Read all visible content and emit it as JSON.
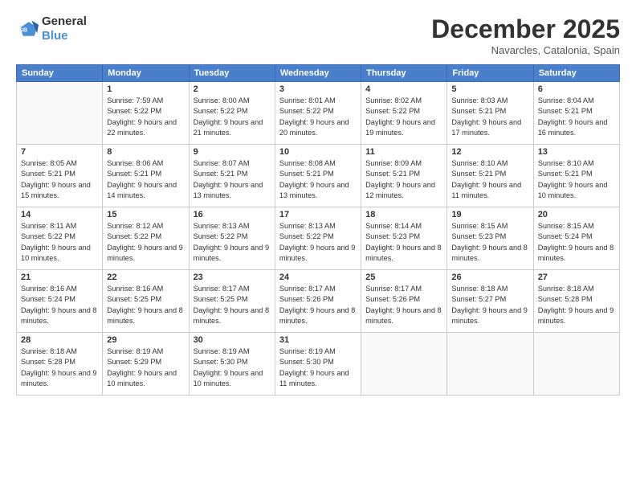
{
  "logo": {
    "general": "General",
    "blue": "Blue"
  },
  "title": "December 2025",
  "location": "Navarcles, Catalonia, Spain",
  "days_header": [
    "Sunday",
    "Monday",
    "Tuesday",
    "Wednesday",
    "Thursday",
    "Friday",
    "Saturday"
  ],
  "weeks": [
    [
      {
        "day": "",
        "info": ""
      },
      {
        "day": "1",
        "info": "Sunrise: 7:59 AM\nSunset: 5:22 PM\nDaylight: 9 hours\nand 22 minutes."
      },
      {
        "day": "2",
        "info": "Sunrise: 8:00 AM\nSunset: 5:22 PM\nDaylight: 9 hours\nand 21 minutes."
      },
      {
        "day": "3",
        "info": "Sunrise: 8:01 AM\nSunset: 5:22 PM\nDaylight: 9 hours\nand 20 minutes."
      },
      {
        "day": "4",
        "info": "Sunrise: 8:02 AM\nSunset: 5:22 PM\nDaylight: 9 hours\nand 19 minutes."
      },
      {
        "day": "5",
        "info": "Sunrise: 8:03 AM\nSunset: 5:21 PM\nDaylight: 9 hours\nand 17 minutes."
      },
      {
        "day": "6",
        "info": "Sunrise: 8:04 AM\nSunset: 5:21 PM\nDaylight: 9 hours\nand 16 minutes."
      }
    ],
    [
      {
        "day": "7",
        "info": "Sunrise: 8:05 AM\nSunset: 5:21 PM\nDaylight: 9 hours\nand 15 minutes."
      },
      {
        "day": "8",
        "info": "Sunrise: 8:06 AM\nSunset: 5:21 PM\nDaylight: 9 hours\nand 14 minutes."
      },
      {
        "day": "9",
        "info": "Sunrise: 8:07 AM\nSunset: 5:21 PM\nDaylight: 9 hours\nand 13 minutes."
      },
      {
        "day": "10",
        "info": "Sunrise: 8:08 AM\nSunset: 5:21 PM\nDaylight: 9 hours\nand 13 minutes."
      },
      {
        "day": "11",
        "info": "Sunrise: 8:09 AM\nSunset: 5:21 PM\nDaylight: 9 hours\nand 12 minutes."
      },
      {
        "day": "12",
        "info": "Sunrise: 8:10 AM\nSunset: 5:21 PM\nDaylight: 9 hours\nand 11 minutes."
      },
      {
        "day": "13",
        "info": "Sunrise: 8:10 AM\nSunset: 5:21 PM\nDaylight: 9 hours\nand 10 minutes."
      }
    ],
    [
      {
        "day": "14",
        "info": "Sunrise: 8:11 AM\nSunset: 5:22 PM\nDaylight: 9 hours\nand 10 minutes."
      },
      {
        "day": "15",
        "info": "Sunrise: 8:12 AM\nSunset: 5:22 PM\nDaylight: 9 hours\nand 9 minutes."
      },
      {
        "day": "16",
        "info": "Sunrise: 8:13 AM\nSunset: 5:22 PM\nDaylight: 9 hours\nand 9 minutes."
      },
      {
        "day": "17",
        "info": "Sunrise: 8:13 AM\nSunset: 5:22 PM\nDaylight: 9 hours\nand 9 minutes."
      },
      {
        "day": "18",
        "info": "Sunrise: 8:14 AM\nSunset: 5:23 PM\nDaylight: 9 hours\nand 8 minutes."
      },
      {
        "day": "19",
        "info": "Sunrise: 8:15 AM\nSunset: 5:23 PM\nDaylight: 9 hours\nand 8 minutes."
      },
      {
        "day": "20",
        "info": "Sunrise: 8:15 AM\nSunset: 5:24 PM\nDaylight: 9 hours\nand 8 minutes."
      }
    ],
    [
      {
        "day": "21",
        "info": "Sunrise: 8:16 AM\nSunset: 5:24 PM\nDaylight: 9 hours\nand 8 minutes."
      },
      {
        "day": "22",
        "info": "Sunrise: 8:16 AM\nSunset: 5:25 PM\nDaylight: 9 hours\nand 8 minutes."
      },
      {
        "day": "23",
        "info": "Sunrise: 8:17 AM\nSunset: 5:25 PM\nDaylight: 9 hours\nand 8 minutes."
      },
      {
        "day": "24",
        "info": "Sunrise: 8:17 AM\nSunset: 5:26 PM\nDaylight: 9 hours\nand 8 minutes."
      },
      {
        "day": "25",
        "info": "Sunrise: 8:17 AM\nSunset: 5:26 PM\nDaylight: 9 hours\nand 8 minutes."
      },
      {
        "day": "26",
        "info": "Sunrise: 8:18 AM\nSunset: 5:27 PM\nDaylight: 9 hours\nand 9 minutes."
      },
      {
        "day": "27",
        "info": "Sunrise: 8:18 AM\nSunset: 5:28 PM\nDaylight: 9 hours\nand 9 minutes."
      }
    ],
    [
      {
        "day": "28",
        "info": "Sunrise: 8:18 AM\nSunset: 5:28 PM\nDaylight: 9 hours\nand 9 minutes."
      },
      {
        "day": "29",
        "info": "Sunrise: 8:19 AM\nSunset: 5:29 PM\nDaylight: 9 hours\nand 10 minutes."
      },
      {
        "day": "30",
        "info": "Sunrise: 8:19 AM\nSunset: 5:30 PM\nDaylight: 9 hours\nand 10 minutes."
      },
      {
        "day": "31",
        "info": "Sunrise: 8:19 AM\nSunset: 5:30 PM\nDaylight: 9 hours\nand 11 minutes."
      },
      {
        "day": "",
        "info": ""
      },
      {
        "day": "",
        "info": ""
      },
      {
        "day": "",
        "info": ""
      }
    ]
  ]
}
